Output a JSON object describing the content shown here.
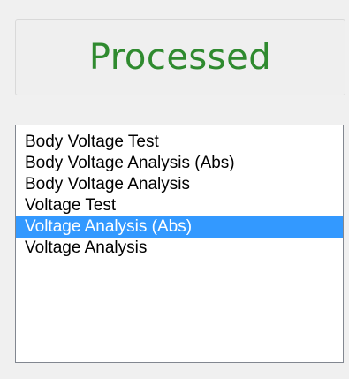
{
  "status": {
    "label": "Processed",
    "color": "#2f8a2f"
  },
  "list": {
    "items": [
      {
        "label": "Body Voltage Test",
        "selected": false
      },
      {
        "label": "Body Voltage Analysis (Abs)",
        "selected": false
      },
      {
        "label": "Body Voltage Analysis",
        "selected": false
      },
      {
        "label": "Voltage Test",
        "selected": false
      },
      {
        "label": "Voltage Analysis (Abs)",
        "selected": true
      },
      {
        "label": "Voltage Analysis",
        "selected": false
      }
    ],
    "selection_color": "#3399ff"
  }
}
